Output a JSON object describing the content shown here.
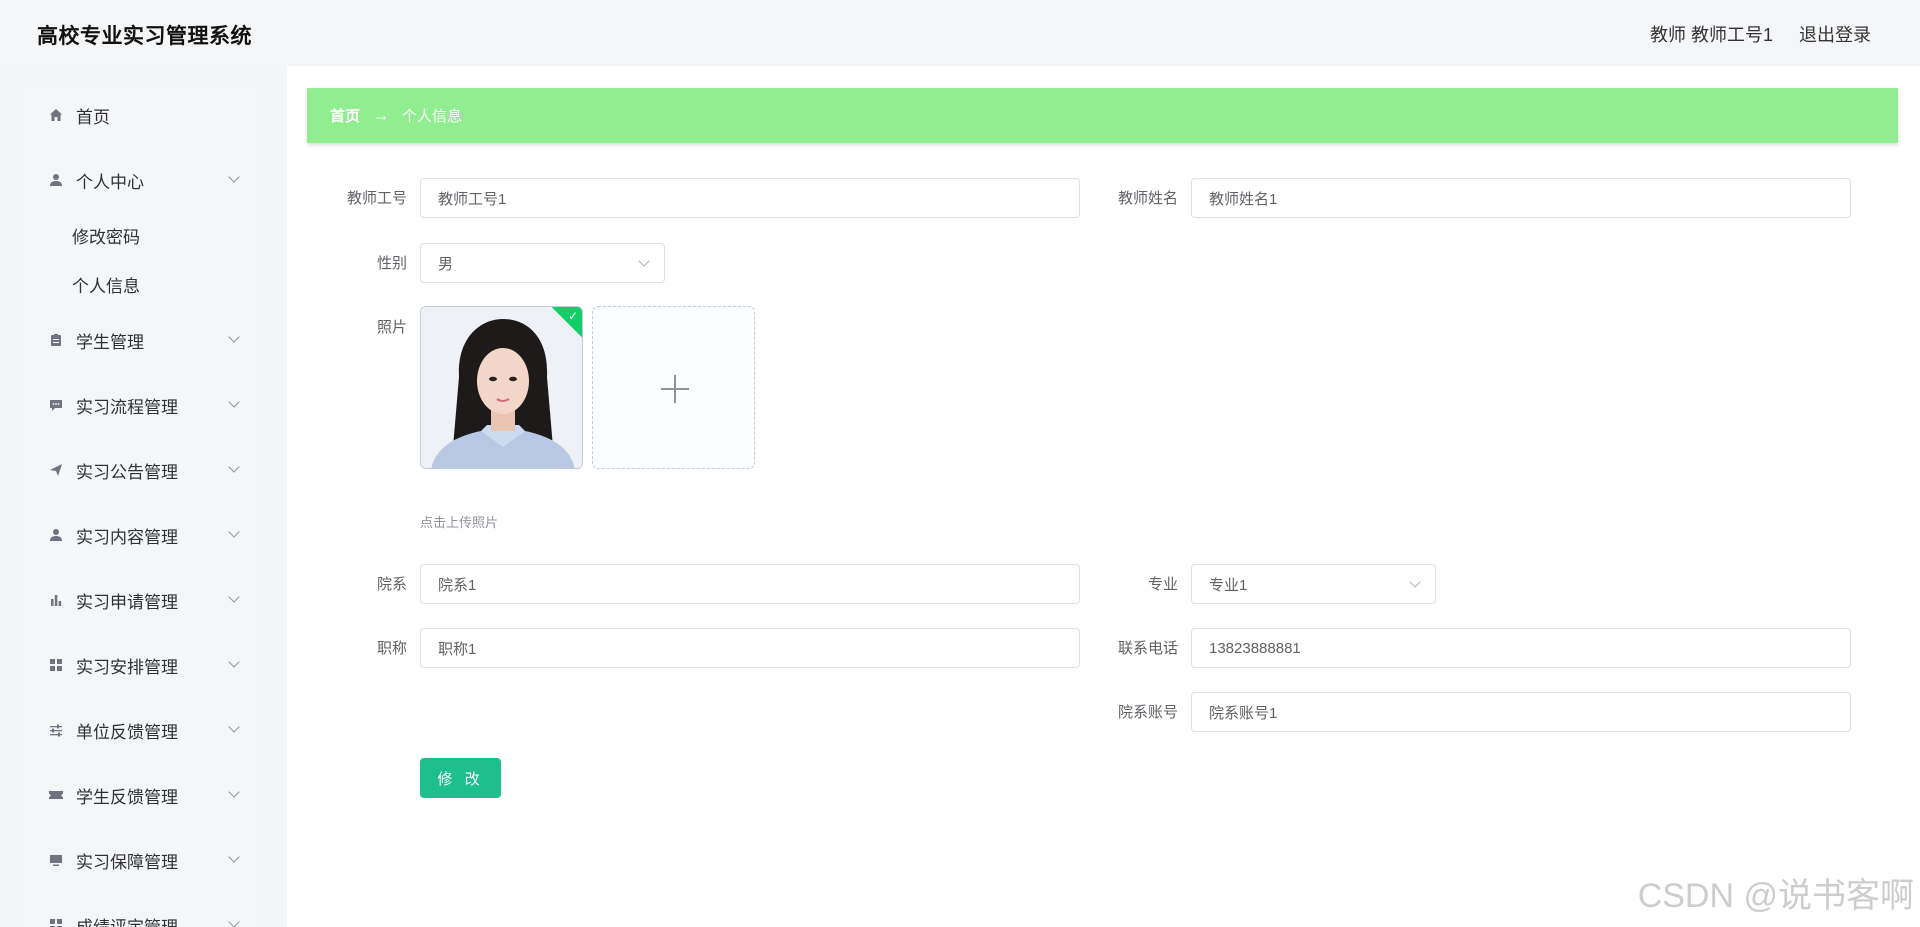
{
  "header": {
    "title": "高校专业实习管理系统",
    "user": "教师 教师工号1",
    "logout": "退出登录"
  },
  "sidebar": {
    "items": [
      {
        "label": "首页",
        "icon": "home-icon"
      },
      {
        "label": "个人中心",
        "icon": "user-icon"
      },
      {
        "label": "学生管理",
        "icon": "clipboard-icon"
      },
      {
        "label": "实习流程管理",
        "icon": "chat-icon"
      },
      {
        "label": "实习公告管理",
        "icon": "send-icon"
      },
      {
        "label": "实习内容管理",
        "icon": "user-icon"
      },
      {
        "label": "实习申请管理",
        "icon": "bar-chart-icon"
      },
      {
        "label": "实习安排管理",
        "icon": "grid-icon"
      },
      {
        "label": "单位反馈管理",
        "icon": "sliders-icon"
      },
      {
        "label": "学生反馈管理",
        "icon": "ticket-icon"
      },
      {
        "label": "实习保障管理",
        "icon": "monitor-icon"
      },
      {
        "label": "成绩评定管理",
        "icon": "grid-icon"
      }
    ],
    "subitems": [
      "修改密码",
      "个人信息"
    ]
  },
  "breadcrumb": {
    "home": "首页",
    "arrow": "→",
    "current": "个人信息"
  },
  "form": {
    "teacher_id_label": "教师工号",
    "teacher_id_value": "教师工号1",
    "teacher_name_label": "教师姓名",
    "teacher_name_value": "教师姓名1",
    "gender_label": "性别",
    "gender_value": "男",
    "photo_label": "照片",
    "upload_tip": "点击上传照片",
    "department_label": "院系",
    "department_value": "院系1",
    "major_label": "专业",
    "major_value": "专业1",
    "title_label": "职称",
    "title_value": "职称1",
    "phone_label": "联系电话",
    "phone_value": "13823888881",
    "dept_account_label": "院系账号",
    "dept_account_value": "院系账号1",
    "submit_label": "修 改"
  },
  "watermark": "CSDN @说书客啊",
  "colors": {
    "breadcrumb_bg": "#90ee90",
    "submit_bg": "#1ebf8c",
    "upload_success": "#13ce66"
  }
}
